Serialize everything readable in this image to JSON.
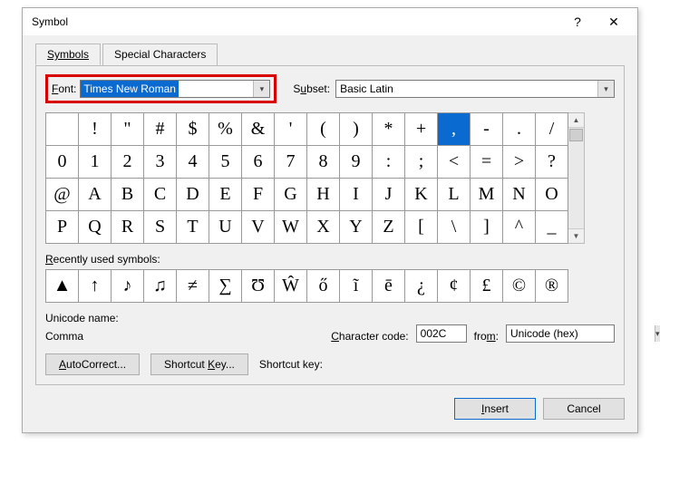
{
  "title": "Symbol",
  "titlebar": {
    "help_label": "?",
    "close_label": "✕"
  },
  "tabs": {
    "symbols": "Symbols",
    "special": "Special Characters"
  },
  "font": {
    "label": "Font:",
    "value": "Times New Roman"
  },
  "subset": {
    "label": "Subset:",
    "value": "Basic Latin"
  },
  "grid": {
    "rows": [
      [
        "",
        "!",
        "\"",
        "#",
        "$",
        "%",
        "&",
        "'",
        "(",
        ")",
        "*",
        "+",
        ",",
        "-",
        ".",
        "/"
      ],
      [
        "0",
        "1",
        "2",
        "3",
        "4",
        "5",
        "6",
        "7",
        "8",
        "9",
        ":",
        ";",
        "<",
        "=",
        ">",
        "?"
      ],
      [
        "@",
        "A",
        "B",
        "C",
        "D",
        "E",
        "F",
        "G",
        "H",
        "I",
        "J",
        "K",
        "L",
        "M",
        "N",
        "O"
      ],
      [
        "P",
        "Q",
        "R",
        "S",
        "T",
        "U",
        "V",
        "W",
        "X",
        "Y",
        "Z",
        "[",
        "\\",
        "]",
        "^",
        "_"
      ]
    ],
    "selected": {
      "row": 0,
      "col": 12
    }
  },
  "recent": {
    "label": "Recently used symbols:",
    "items": [
      "▲",
      "↑",
      "♪",
      "♫",
      "≠",
      "∑",
      "Ʊ",
      "Ŵ",
      "ő",
      "ĩ",
      "ē",
      "¿",
      "¢",
      "£",
      "©",
      "®"
    ]
  },
  "unicode_name": {
    "label": "Unicode name:",
    "value": "Comma"
  },
  "char_code": {
    "label": "Character code:",
    "value": "002C"
  },
  "from": {
    "label": "from:",
    "value": "Unicode (hex)"
  },
  "autocorrect_btn": "AutoCorrect...",
  "shortcutkey_btn": "Shortcut Key...",
  "shortcutkey_label": "Shortcut key:",
  "shortcutkey_value": "",
  "insert_btn": "Insert",
  "cancel_btn": "Cancel"
}
